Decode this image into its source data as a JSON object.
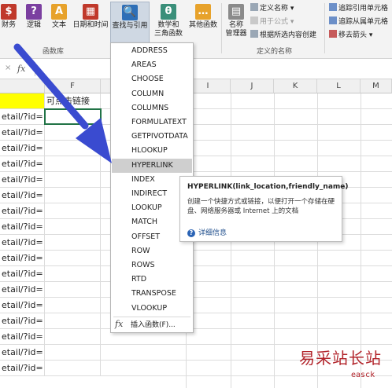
{
  "ribbon": {
    "buttons": [
      {
        "label": "财务",
        "icon": "finance-icon",
        "color": "#c0392b"
      },
      {
        "label": "逻辑",
        "icon": "logic-icon",
        "color": "#7b3fa0"
      },
      {
        "label": "文本",
        "icon": "text-icon",
        "color": "#e7a22b"
      },
      {
        "label": "日期和时间",
        "icon": "date-time-icon",
        "color": "#c0392b"
      },
      {
        "label": "查找与引用",
        "icon": "lookup-reference-icon",
        "color": "#2e6fb7"
      },
      {
        "label": "数学和\n三角函数",
        "icon": "math-trig-icon",
        "color": "#3a8f7a"
      },
      {
        "label": "其他函数",
        "icon": "more-functions-icon",
        "color": "#e7a22b"
      }
    ],
    "group_function_library": "函数库",
    "name_manager": "名称\n管理器",
    "define_name": "定义名称",
    "use_in_formula": "用于公式",
    "create_from_selection": "根据所选内容创建",
    "group_defined_names": "定义的名称",
    "trace_precedents": "追踪引用单元格",
    "trace_dependents": "追踪从属单元格",
    "remove_arrows": "移去箭头"
  },
  "formula_bar": {
    "fx": "fx",
    "cancel": "×"
  },
  "columns": [
    "F",
    "I",
    "J",
    "K",
    "L",
    "M"
  ],
  "header_cell_F": "可点击链接",
  "cells_A": [
    "etail/?id=",
    "etail/?id=",
    "etail/?id=",
    "etail/?id=",
    "etail/?id=",
    "etail/?id=",
    "etail/?id=",
    "etail/?id=",
    "etail/?id=",
    "etail/?id=",
    "etail/?id=",
    "etail/?id=",
    "etail/?id=",
    "etail/?id=",
    "etail/?id=",
    "etail/?id=",
    "etail/?id="
  ],
  "menu": {
    "items": [
      "ADDRESS",
      "AREAS",
      "CHOOSE",
      "COLUMN",
      "COLUMNS",
      "FORMULATEXT",
      "GETPIVOTDATA",
      "HLOOKUP",
      "HYPERLINK",
      "INDEX",
      "INDIRECT",
      "LOOKUP",
      "MATCH",
      "OFFSET",
      "ROW",
      "ROWS",
      "RTD",
      "TRANSPOSE",
      "VLOOKUP"
    ],
    "selected": "HYPERLINK",
    "insert_function": "插入函数(F)...",
    "fx": "fx"
  },
  "tooltip": {
    "signature": "HYPERLINK(link_location,friendly_name)",
    "description": "创建一个快捷方式或链接，以便打开一个存储在硬盘、网络服务器或 Internet 上的文档",
    "help": "详细信息"
  },
  "watermark": {
    "text": "易采站长站",
    "sub": "easck"
  },
  "colors": {
    "highlight_yellow": "#ffff00",
    "arrow_blue": "#3a4bd0",
    "menu_selected": "#cfcfcf"
  }
}
